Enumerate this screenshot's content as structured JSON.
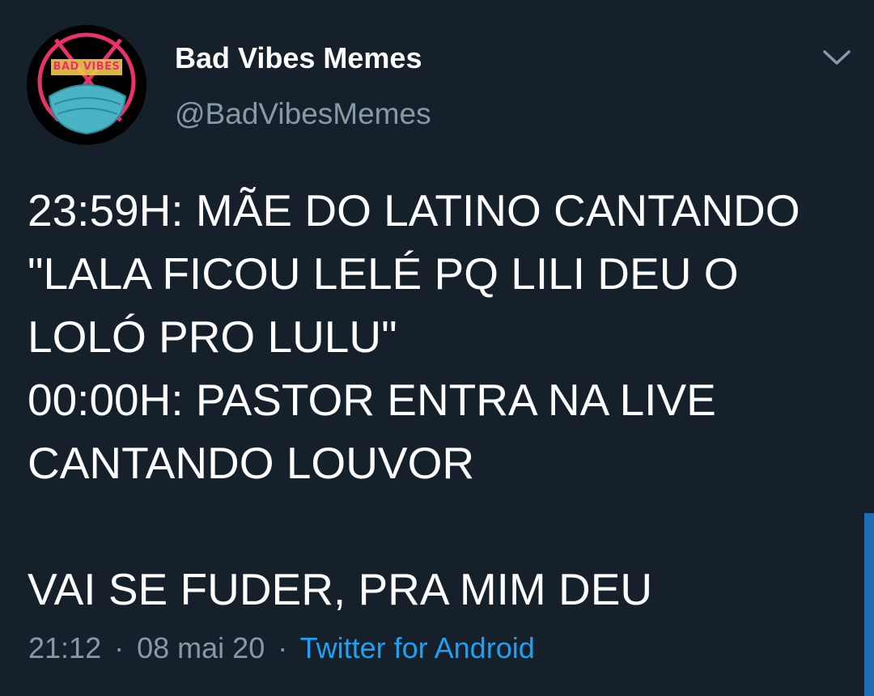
{
  "tweet": {
    "display_name": "Bad Vibes Memes",
    "handle": "@BadVibesMemes",
    "avatar_badge_text": "BAD VIBES",
    "text": "23:59H: MÃE DO LATINO CANTANDO \"LALA FICOU LELÉ PQ LILI DEU O LOLÓ PRO LULU\"\n00:00H: PASTOR ENTRA NA LIVE CANTANDO LOUVOR\n\nVAI SE FUDER, PRA MIM DEU",
    "time": "21:12",
    "date": "08 mai 20",
    "separator": "·",
    "source": "Twitter for Android"
  },
  "icons": {
    "menu": "chevron-down-icon"
  },
  "colors": {
    "background": "#15202b",
    "primary_text": "#ffffff",
    "secondary_text": "#8899a6",
    "link": "#1da1f2",
    "avatar_accent": "#e8326b",
    "mask": "#4ab3c4"
  }
}
